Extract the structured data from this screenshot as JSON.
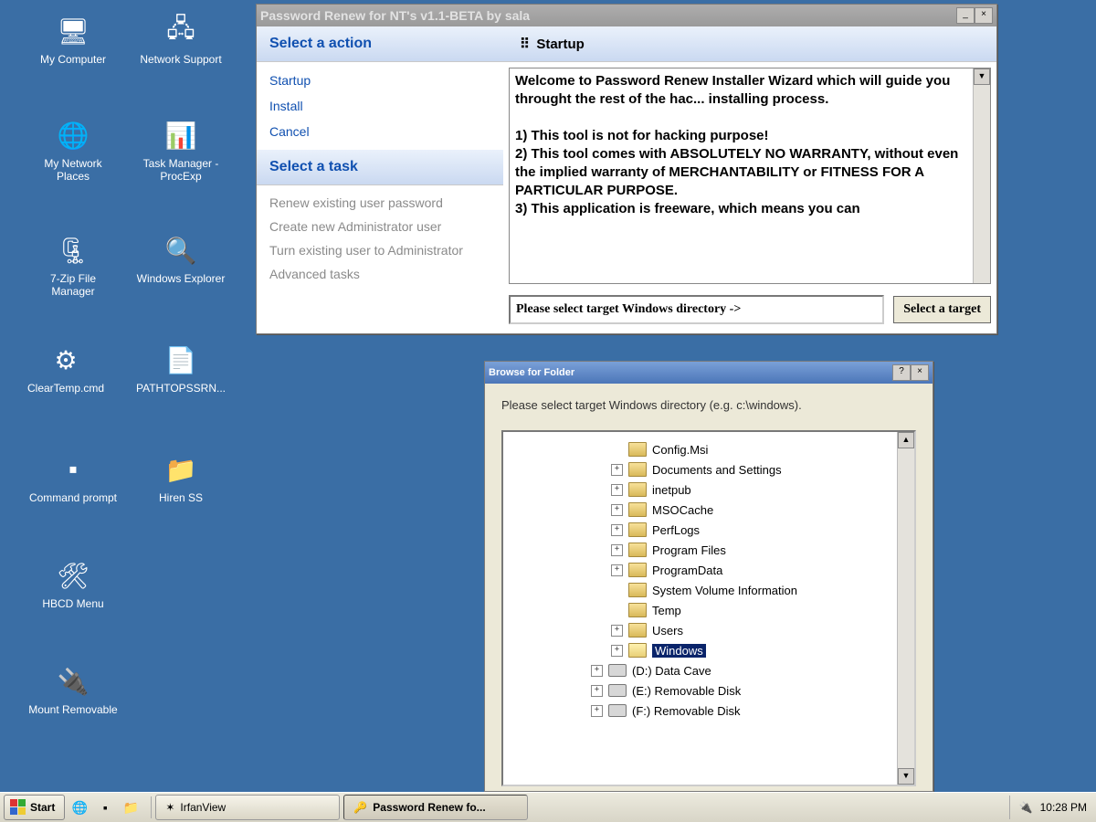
{
  "desktop_icons": [
    {
      "label": "My Computer",
      "g": "computer"
    },
    {
      "label": "Network Support",
      "g": "network"
    },
    {
      "label": "My Network Places",
      "g": "netplaces"
    },
    {
      "label": "Task Manager - ProcExp",
      "g": "taskmgr"
    },
    {
      "label": "7-Zip File Manager",
      "g": "sevenzip"
    },
    {
      "label": "Windows Explorer",
      "g": "folder-search"
    },
    {
      "label": "ClearTemp.cmd",
      "g": "gear"
    },
    {
      "label": "PATHTOPSSRN...",
      "g": "doc"
    },
    {
      "label": "Command prompt",
      "g": "cmd"
    },
    {
      "label": "Hiren SS",
      "g": "folder"
    },
    {
      "label": "HBCD Menu",
      "g": "tools"
    },
    {
      "label": "Mount Removable",
      "g": "usb"
    }
  ],
  "pw": {
    "title": "Password Renew for NT's v1.1-BETA by sala",
    "select_action_hdr": "Select a action",
    "actions": [
      "Startup",
      "Install",
      "Cancel"
    ],
    "select_task_hdr": "Select a task",
    "tasks": [
      "Renew existing user password",
      "Create new Administrator user",
      "Turn existing user to Administrator",
      "Advanced tasks"
    ],
    "right_hdr": "Startup",
    "content": "Welcome to Password Renew Installer Wizard which will guide you throught the rest of the hac... installing process.\n\n1) This tool is not for hacking purpose!\n2) This tool comes with ABSOLUTELY NO WARRANTY, without even the implied warranty of MERCHANTABILITY or FITNESS FOR A PARTICULAR PURPOSE.\n3) This application is freeware, which means you can",
    "target_msg": "Please select target Windows directory ->",
    "target_btn": "Select a target"
  },
  "bf": {
    "title": "Browse for Folder",
    "msg": "Please select target Windows directory (e.g. c:\\windows).",
    "nodes": [
      {
        "ind": "ind1",
        "exp": "",
        "type": "closed",
        "label": "Config.Msi"
      },
      {
        "ind": "ind1",
        "exp": "+",
        "type": "closed",
        "label": "Documents and Settings"
      },
      {
        "ind": "ind1",
        "exp": "+",
        "type": "closed",
        "label": "inetpub"
      },
      {
        "ind": "ind1",
        "exp": "+",
        "type": "closed",
        "label": "MSOCache"
      },
      {
        "ind": "ind1",
        "exp": "+",
        "type": "closed",
        "label": "PerfLogs"
      },
      {
        "ind": "ind1",
        "exp": "+",
        "type": "closed",
        "label": "Program Files"
      },
      {
        "ind": "ind1",
        "exp": "+",
        "type": "closed",
        "label": "ProgramData"
      },
      {
        "ind": "ind1",
        "exp": "",
        "type": "closed",
        "label": "System Volume Information"
      },
      {
        "ind": "ind1",
        "exp": "",
        "type": "closed",
        "label": "Temp"
      },
      {
        "ind": "ind1",
        "exp": "+",
        "type": "closed",
        "label": "Users"
      },
      {
        "ind": "ind1",
        "exp": "+",
        "type": "open",
        "label": "Windows",
        "sel": true
      },
      {
        "ind": "ind0",
        "exp": "+",
        "type": "drive",
        "label": "(D:) Data Cave"
      },
      {
        "ind": "ind0",
        "exp": "+",
        "type": "drive",
        "label": "(E:) Removable Disk"
      },
      {
        "ind": "ind0",
        "exp": "+",
        "type": "drive",
        "label": "(F:) Removable Disk"
      }
    ]
  },
  "taskbar": {
    "start": "Start",
    "tasks": [
      {
        "label": "IrfanView",
        "active": false,
        "g": "star"
      },
      {
        "label": "Password Renew fo...",
        "active": true,
        "g": "key"
      }
    ],
    "clock": "10:28 PM"
  }
}
